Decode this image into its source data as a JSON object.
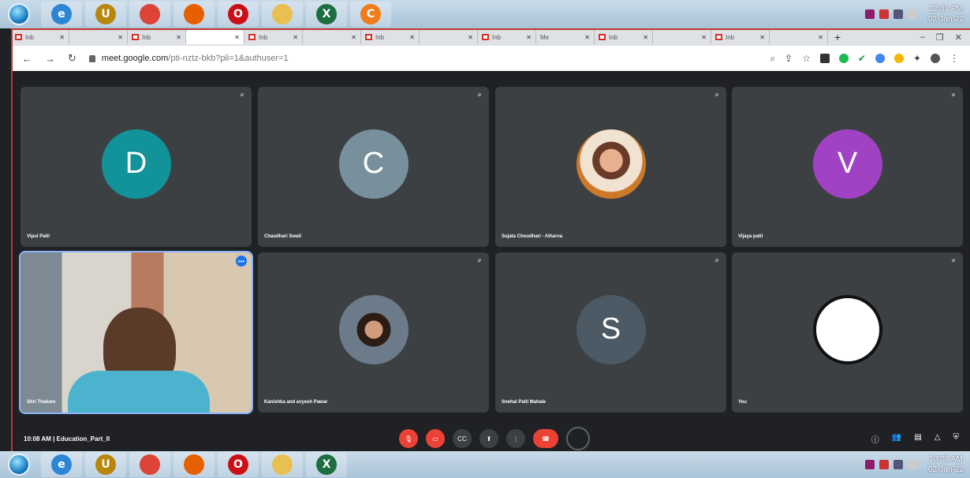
{
  "taskbar": {
    "apps": [
      {
        "name": "ie-icon",
        "glyph": "e",
        "color": "#2d86d4"
      },
      {
        "name": "shield-app-icon",
        "glyph": "U",
        "color": "#b8860b"
      },
      {
        "name": "chrome-icon",
        "glyph": "",
        "color": "#db4437"
      },
      {
        "name": "firefox-icon",
        "glyph": "",
        "color": "#e66000"
      },
      {
        "name": "opera-icon",
        "glyph": "O",
        "color": "#cc0f16"
      },
      {
        "name": "folder-icon",
        "glyph": "",
        "color": "#e8c050"
      },
      {
        "name": "excel-icon",
        "glyph": "X",
        "color": "#1d6f42"
      },
      {
        "name": "app-orange-icon",
        "glyph": "C",
        "color": "#f07c1c"
      }
    ],
    "top_clock": {
      "time": "12:01 PM",
      "date": "02-Jan-22"
    },
    "bottom_clock": {
      "time": "10:08 AM",
      "date": "02-Jan-22"
    }
  },
  "tabs": [
    {
      "type": "gmail",
      "label": "Inb"
    },
    {
      "type": "meet",
      "label": ""
    },
    {
      "type": "gmail",
      "label": "Inb"
    },
    {
      "type": "meet",
      "label": "",
      "active": true
    },
    {
      "type": "gmail",
      "label": "Inb"
    },
    {
      "type": "meet",
      "label": ""
    },
    {
      "type": "gmail",
      "label": "Inb"
    },
    {
      "type": "meet",
      "label": ""
    },
    {
      "type": "gmail",
      "label": "Inb"
    },
    {
      "type": "meet",
      "label": "Me"
    },
    {
      "type": "gmail",
      "label": "Inb"
    },
    {
      "type": "meet",
      "label": ""
    },
    {
      "type": "gmail",
      "label": "Inb"
    },
    {
      "type": "meet",
      "label": ""
    }
  ],
  "address": {
    "domain": "meet.google.com",
    "path": "/pti-nztz-bkb?pli=1&authuser=1"
  },
  "participants": [
    {
      "name": "Vipul Patil",
      "initial": "D",
      "color": "#12939a",
      "kind": "initial"
    },
    {
      "name": "Chaudhari Swati",
      "initial": "C",
      "color": "#78909c",
      "kind": "initial"
    },
    {
      "name": "Sujata Choudhari - Atharva",
      "initial": "",
      "color": "",
      "kind": "photo"
    },
    {
      "name": "Vijaya patil",
      "initial": "V",
      "color": "#a142c4",
      "kind": "initial"
    },
    {
      "name": "Shri Thakare",
      "initial": "",
      "color": "",
      "kind": "video"
    },
    {
      "name": "Kanishka and avyesh Pawar",
      "initial": "",
      "color": "",
      "kind": "photo2"
    },
    {
      "name": "Snehal Patil Mahale",
      "initial": "S",
      "color": "#4b5a64",
      "kind": "s"
    },
    {
      "name": "You",
      "initial": "",
      "color": "",
      "kind": "logo"
    }
  ],
  "meeting": {
    "time": "10:08 AM",
    "separator": "|",
    "title": "Education_Part_II"
  }
}
